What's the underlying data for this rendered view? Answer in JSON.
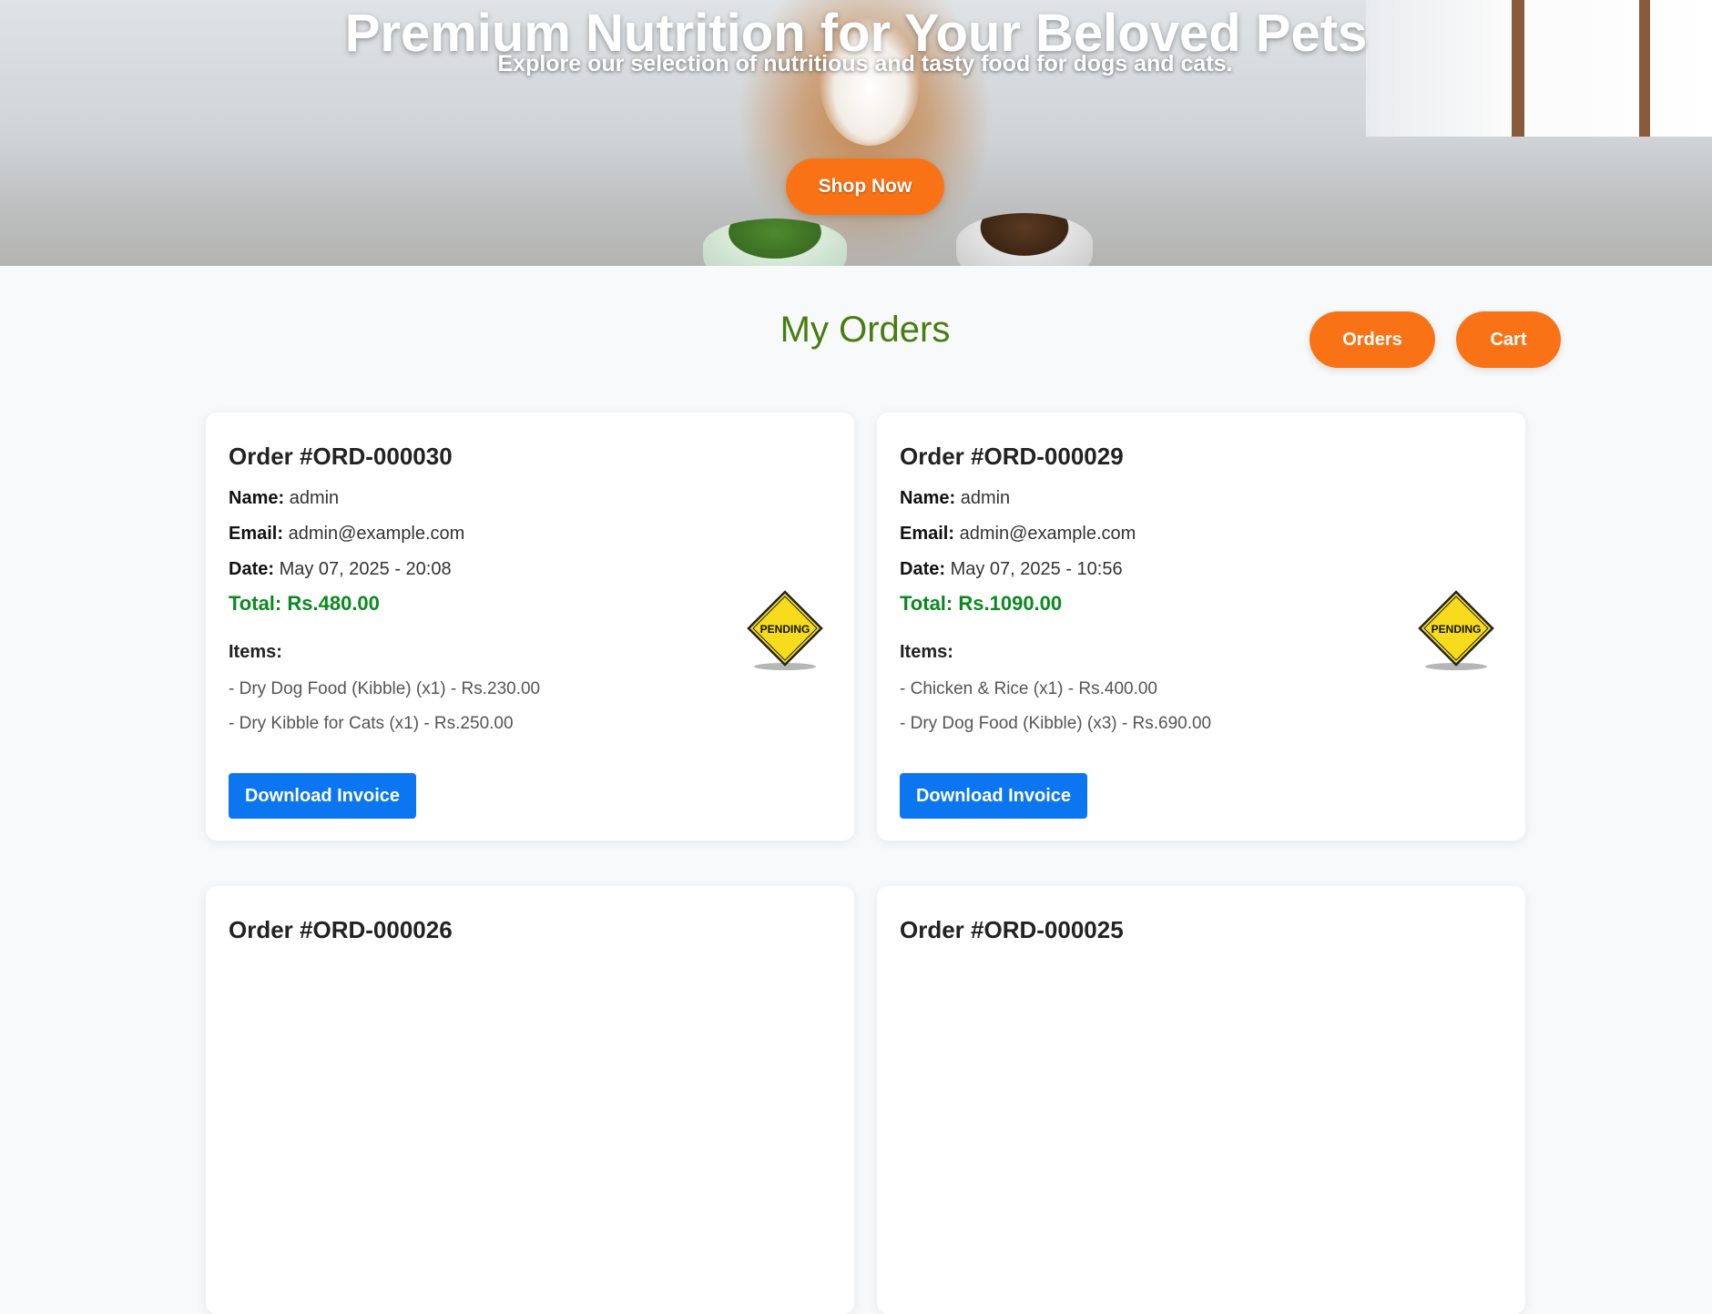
{
  "hero": {
    "title": "Premium Nutrition for Your Beloved Pets",
    "subtitle": "Explore our selection of nutritious and tasty food for dogs and cats.",
    "cta_label": "Shop Now"
  },
  "orders_section": {
    "title": "My Orders",
    "nav": {
      "orders_label": "Orders",
      "cart_label": "Cart"
    }
  },
  "labels": {
    "name": "Name:",
    "email": "Email:",
    "date": "Date:",
    "total": "Total:",
    "items": "Items:",
    "download": "Download Invoice",
    "status_text": "PENDING"
  },
  "orders": [
    {
      "heading": "Order #ORD-000030",
      "name": "admin",
      "email": "admin@example.com",
      "date": "May 07, 2025 - 20:08",
      "total": "Rs.480.00",
      "status": "pending",
      "items": [
        "- Dry Dog Food (Kibble) (x1) - Rs.230.00",
        "- Dry Kibble for Cats (x1) - Rs.250.00"
      ]
    },
    {
      "heading": "Order #ORD-000029",
      "name": "admin",
      "email": "admin@example.com",
      "date": "May 07, 2025 - 10:56",
      "total": "Rs.1090.00",
      "status": "pending",
      "items": [
        "- Chicken & Rice (x1) - Rs.400.00",
        "- Dry Dog Food (Kibble) (x3) - Rs.690.00"
      ]
    },
    {
      "heading": "Order #ORD-000026"
    },
    {
      "heading": "Order #ORD-000025"
    }
  ],
  "colors": {
    "accent_orange": "#f97316",
    "title_green": "#4a7c11",
    "total_green": "#0a8a1e",
    "button_blue": "#0b76f0",
    "pending_yellow": "#f7dc1e"
  },
  "icons": {
    "status": "pending-sign-icon"
  }
}
